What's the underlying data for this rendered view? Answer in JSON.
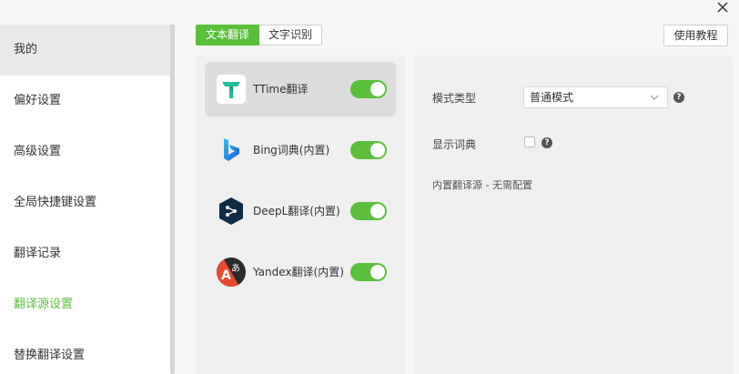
{
  "window": {
    "close_icon": "close-icon"
  },
  "sidebar": {
    "items": [
      {
        "label": "我的"
      },
      {
        "label": "偏好设置"
      },
      {
        "label": "高级设置"
      },
      {
        "label": "全局快捷键设置"
      },
      {
        "label": "翻译记录"
      },
      {
        "label": "翻译源设置"
      },
      {
        "label": "替换翻译设置"
      }
    ],
    "active_index": 5,
    "active_color": "#5bbf3b"
  },
  "tabs": [
    {
      "label": "文本翻译",
      "active": true
    },
    {
      "label": "文字识别",
      "active": false
    }
  ],
  "help_button": {
    "label": "使用教程"
  },
  "sources": [
    {
      "name": "TTime翻译",
      "icon": "ttime-logo-icon",
      "enabled": true,
      "selected": true
    },
    {
      "name": "Bing词典(内置)",
      "icon": "bing-logo-icon",
      "enabled": true,
      "selected": false
    },
    {
      "name": "DeepL翻译(内置)",
      "icon": "deepl-logo-icon",
      "enabled": true,
      "selected": false
    },
    {
      "name": "Yandex翻译(内置)",
      "icon": "yandex-logo-icon",
      "enabled": true,
      "selected": false
    }
  ],
  "config": {
    "mode_label": "模式类型",
    "mode_value": "普通模式",
    "dict_label": "显示词典",
    "dict_checked": false,
    "note": "内置翻译源 - 无需配置"
  },
  "colors": {
    "accent": "#5bbf3b"
  }
}
